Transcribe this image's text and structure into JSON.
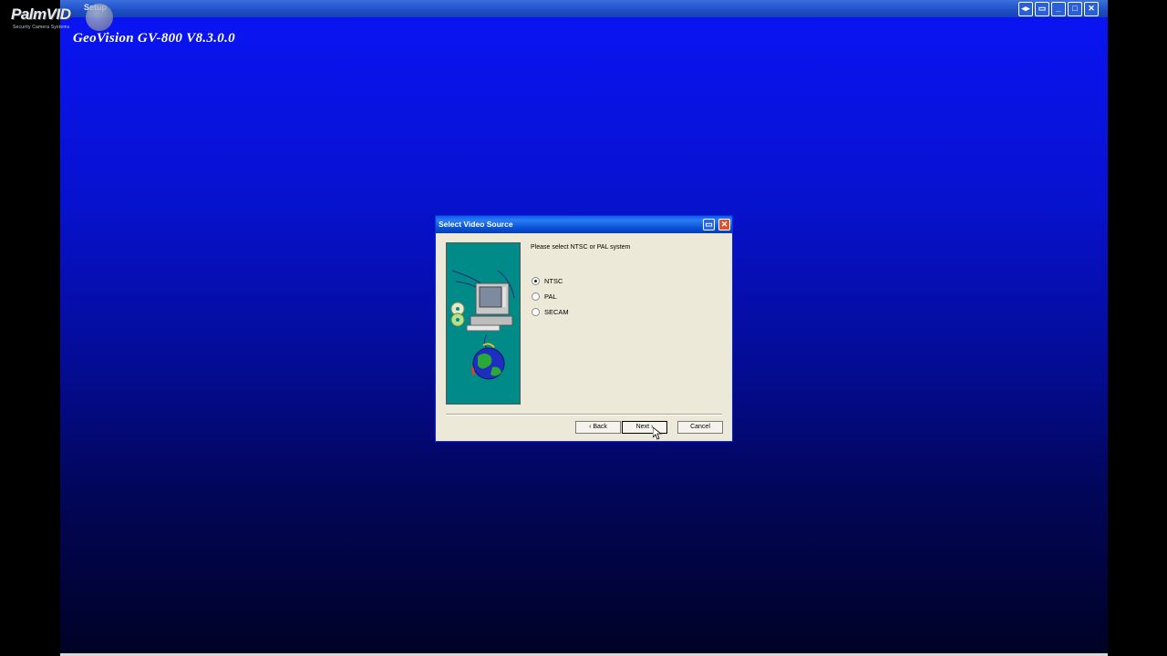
{
  "window": {
    "title": "Setup",
    "app_title": "GeoVision GV-800 V8.3.0.0",
    "buttons": [
      "◂▸",
      "▭",
      "_",
      "□",
      "✕"
    ]
  },
  "watermark": {
    "brand": "PalmVID",
    "tagline": "Security Camera Systems"
  },
  "dialog": {
    "title": "Select Video Source",
    "prompt": "Please select NTSC or PAL system",
    "options": [
      {
        "label": "NTSC",
        "checked": true
      },
      {
        "label": "PAL",
        "checked": false
      },
      {
        "label": "SECAM",
        "checked": false
      }
    ],
    "buttons": {
      "back": "‹ Back",
      "next": "Next ›",
      "cancel": "Cancel"
    }
  },
  "colors": {
    "desktop_top": "#0a14f5",
    "desktop_bottom": "#000224",
    "illustration_bg": "#008a88",
    "dialog_bg": "#ece9d8"
  },
  "icons": [
    "computer-icon",
    "cd-discs-icon",
    "globe-icon",
    "cursor-arrow-icon"
  ]
}
